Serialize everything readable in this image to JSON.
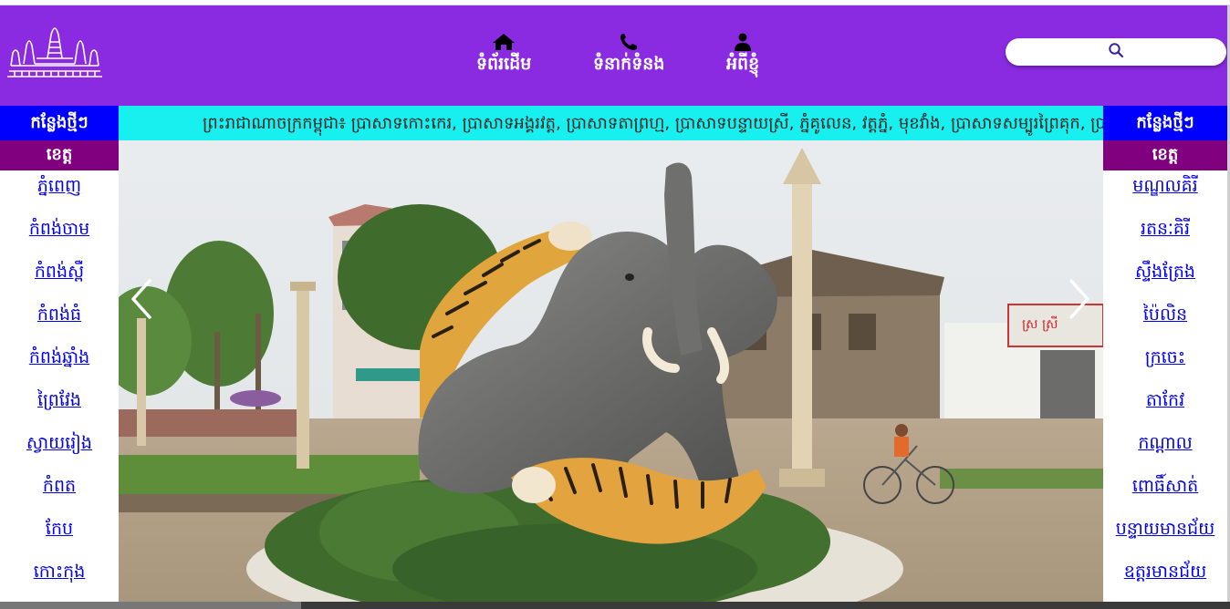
{
  "header": {
    "nav": [
      {
        "label": "ទំព័រដើម",
        "icon": "home-icon"
      },
      {
        "label": "ទំនាក់ទំនង",
        "icon": "phone-icon"
      },
      {
        "label": "អំពីខ្ញុំ",
        "icon": "user-icon"
      }
    ],
    "search": {
      "placeholder": "",
      "icon": "search-icon"
    }
  },
  "ticker": {
    "text": "ព្រះរាជាណាចក្រកម្ពុជា៖ ប្រាសាទកោះកេរ, ប្រាសាទអង្គរវត្ត, ប្រាសាទតាព្រហ្ម, ប្រាសាទបន្ទាយស្រី, ភ្នំគូលេន, វត្តភ្នំ, មុខវាំង, ប្រាសាទសម្បូរព្រៃគុក, ប្រាសាទនាគព័ន្ធ"
  },
  "left_sidebar": {
    "heading": "កន្លែងថ្មីៗ",
    "subheading": "ខេត្ត",
    "items": [
      "ភ្នំពេញ",
      "កំពង់ចាម",
      "កំពង់ស្ពឺ",
      "កំពង់ធំ",
      "កំពង់ឆ្នាំង",
      "ព្រៃវែង",
      "ស្វាយរៀង",
      "កំពត",
      "កែប",
      "កោះកុង"
    ]
  },
  "right_sidebar": {
    "heading": "កន្លែងថ្មីៗ",
    "subheading": "ខេត្ត",
    "items": [
      "មណ្ឌលគិរី",
      "រតនៈគិរី",
      "ស្ទឹងត្រែង",
      "ប៉ៃលិន",
      "ក្រចេះ",
      "តាកែវ",
      "កណ្ដាល",
      "ពោធិ៍សាត់",
      "បន្ទាយមានជ័យ",
      "ឧត្ដរមានជ័យ"
    ]
  },
  "slideshow": {
    "sign_text": "ស្រ ស្រី",
    "prev_icon": "chevron-left-icon",
    "next_icon": "chevron-right-icon"
  },
  "colors": {
    "header_bg": "#8a2be2",
    "ticker_bg": "#18f0f0",
    "sidebar_head_bg": "#0000ff",
    "sidebar_sub_bg": "#800080",
    "link": "#0000ee"
  }
}
